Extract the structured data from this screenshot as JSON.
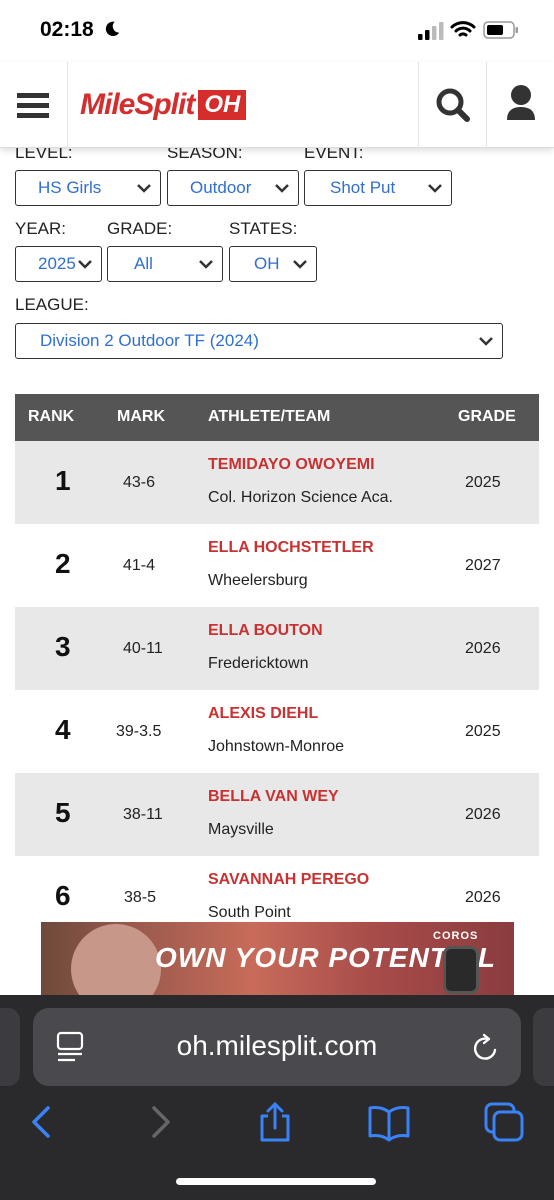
{
  "status_bar": {
    "time": "02:18"
  },
  "header": {
    "logo_text": "MileSplit",
    "logo_state": "OH",
    "menu_icon": "hamburger-icon",
    "search_icon": "search-icon",
    "user_icon": "user-icon"
  },
  "filters": {
    "level": {
      "label": "LEVEL:",
      "value": "HS Girls"
    },
    "season": {
      "label": "SEASON:",
      "value": "Outdoor"
    },
    "event": {
      "label": "EVENT:",
      "value": "Shot Put"
    },
    "year": {
      "label": "YEAR:",
      "value": "2025"
    },
    "grade": {
      "label": "GRADE:",
      "value": "All"
    },
    "states": {
      "label": "STATES:",
      "value": "OH"
    },
    "league": {
      "label": "LEAGUE:",
      "value": "Division 2 Outdoor TF (2024)"
    }
  },
  "table": {
    "headers": {
      "rank": "RANK",
      "mark": "MARK",
      "athlete": "ATHLETE/TEAM",
      "grade": "GRADE"
    },
    "rows": [
      {
        "rank": "1",
        "mark": "43-6",
        "athlete": "TEMIDAYO OWOYEMI",
        "team": "Col. Horizon Science Aca.",
        "grade": "2025"
      },
      {
        "rank": "2",
        "mark": "41-4",
        "athlete": "ELLA HOCHSTETLER",
        "team": "Wheelersburg",
        "grade": "2027"
      },
      {
        "rank": "3",
        "mark": "40-11",
        "athlete": "ELLA BOUTON",
        "team": "Fredericktown",
        "grade": "2026"
      },
      {
        "rank": "4",
        "mark": "39-3.5",
        "athlete": "ALEXIS DIEHL",
        "team": "Johnstown-Monroe",
        "grade": "2025"
      },
      {
        "rank": "5",
        "mark": "38-11",
        "athlete": "BELLA VAN WEY",
        "team": "Maysville",
        "grade": "2026"
      },
      {
        "rank": "6",
        "mark": "38-5",
        "athlete": "SAVANNAH PEREGO",
        "team": "South Point",
        "grade": "2026"
      }
    ]
  },
  "ad": {
    "headline": "OWN YOUR POTENTIAL",
    "brand": "COROS"
  },
  "browser": {
    "url": "oh.milesplit.com",
    "icons": [
      "reader-icon",
      "reload-icon",
      "back-icon",
      "forward-icon",
      "share-icon",
      "bookmarks-icon",
      "tabs-icon"
    ]
  },
  "colors": {
    "brand_red": "#d52c2c",
    "athlete_red": "#c83232",
    "link_blue": "#2f6fd1",
    "table_header": "#555555",
    "ios_blue": "#3a82f7"
  }
}
